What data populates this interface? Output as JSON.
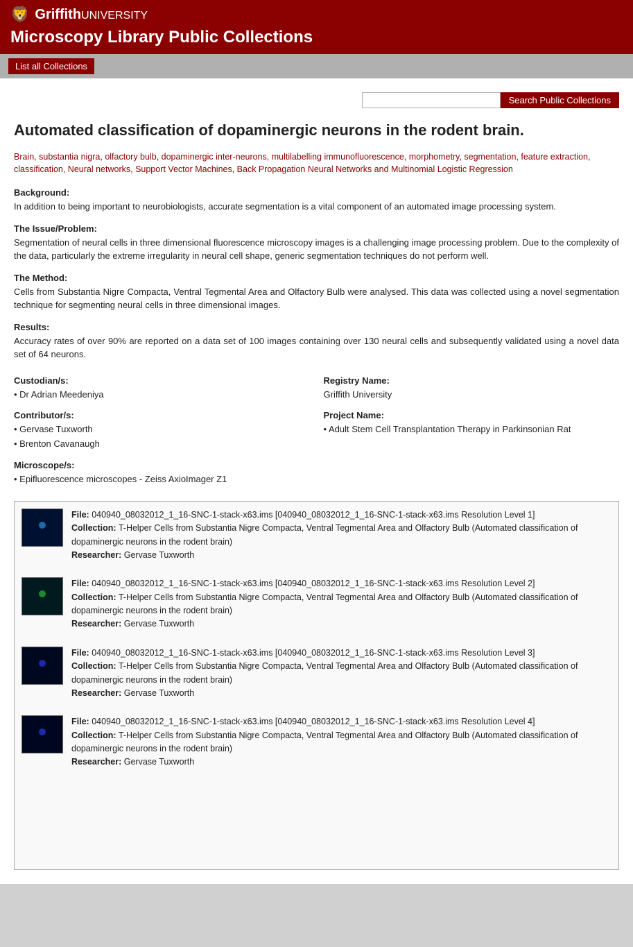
{
  "header": {
    "logo_icon": "🦁",
    "logo_brand": "Griffith",
    "logo_uni": "UNIVERSITY",
    "title": "Microscopy Library Public Collections"
  },
  "toolbar": {
    "list_all_label": "List all Collections"
  },
  "search": {
    "placeholder": "",
    "button_label": "Search Public Collections"
  },
  "page": {
    "title": "Automated classification of dopaminergic neurons in the rodent brain.",
    "keywords": "Brain, substantia nigra, olfactory bulb, dopaminergic inter-neurons, multilabelling immunofluorescence, morphometry, segmentation, feature extraction, classification, Neural networks, Support Vector Machines, Back Propagation Neural Networks and Multinomial Logistic Regression",
    "sections": [
      {
        "label": "Background:",
        "text": "In addition to being important to neurobiologists, accurate segmentation is a vital component of an automated image processing system."
      },
      {
        "label": "The Issue/Problem:",
        "text": "Segmentation of neural cells in three dimensional fluorescence microscopy images is a challenging image processing problem. Due to the complexity of the data, particularly the extreme irregularity in neural cell shape, generic segmentation techniques do not perform well."
      },
      {
        "label": "The Method:",
        "text": "Cells from Substantia Nigre Compacta, Ventral Tegmental Area and Olfactory Bulb were analysed. This data was collected using a novel segmentation technique for segmenting neural cells in three dimensional images."
      },
      {
        "label": "Results:",
        "text": "Accuracy rates of over 90% are reported on a data set of 100 images containing over 130 neural cells and subsequently validated using a novel data set of 64 neurons."
      }
    ],
    "meta": {
      "custodian_label": "Custodian/s:",
      "custodian_values": [
        "Dr Adrian Meedeniya"
      ],
      "contributor_label": "Contributor/s:",
      "contributor_values": [
        "Gervase Tuxworth",
        "Brenton Cavanaugh"
      ],
      "microscope_label": "Microscope/s:",
      "microscope_values": [
        "Epifluorescence microscopes - Zeiss AxioImager Z1"
      ],
      "registry_label": "Registry Name:",
      "registry_value": "Griffith University",
      "project_label": "Project Name:",
      "project_values": [
        "Adult Stem Cell Transplantation Therapy in Parkinsonian Rat"
      ]
    },
    "files": [
      {
        "file_label": "File:",
        "file_name": "040940_08032012_1_16-SNC-1-stack-x63.ims [040940_08032012_1_16-SNC-1-stack-x63.ims Resolution Level 1]",
        "collection_label": "Collection:",
        "collection_name": "T-Helper Cells from Substantia Nigre Compacta, Ventral Tegmental Area and Olfactory Bulb (Automated classification of dopaminergic neurons in the rodent brain)",
        "researcher_label": "Researcher:",
        "researcher_name": "Gervase Tuxworth",
        "thumb_class": "thumb-1"
      },
      {
        "file_label": "File:",
        "file_name": "040940_08032012_1_16-SNC-1-stack-x63.ims [040940_08032012_1_16-SNC-1-stack-x63.ims Resolution Level 2]",
        "collection_label": "Collection:",
        "collection_name": "T-Helper Cells from Substantia Nigre Compacta, Ventral Tegmental Area and Olfactory Bulb (Automated classification of dopaminergic neurons in the rodent brain)",
        "researcher_label": "Researcher:",
        "researcher_name": "Gervase Tuxworth",
        "thumb_class": "thumb-2"
      },
      {
        "file_label": "File:",
        "file_name": "040940_08032012_1_16-SNC-1-stack-x63.ims [040940_08032012_1_16-SNC-1-stack-x63.ims Resolution Level 3]",
        "collection_label": "Collection:",
        "collection_name": "T-Helper Cells from Substantia Nigre Compacta, Ventral Tegmental Area and Olfactory Bulb (Automated classification of dopaminergic neurons in the rodent brain)",
        "researcher_label": "Researcher:",
        "researcher_name": "Gervase Tuxworth",
        "thumb_class": "thumb-3"
      },
      {
        "file_label": "File:",
        "file_name": "040940_08032012_1_16-SNC-1-stack-x63.ims [040940_08032012_1_16-SNC-1-stack-x63.ims Resolution Level 4]",
        "collection_label": "Collection:",
        "collection_name": "T-Helper Cells from Substantia Nigre Compacta, Ventral Tegmental Area and Olfactory Bulb (Automated classification of dopaminergic neurons in the rodent brain)",
        "researcher_label": "Researcher:",
        "researcher_name": "Gervase Tuxworth",
        "thumb_class": "thumb-4"
      }
    ]
  }
}
